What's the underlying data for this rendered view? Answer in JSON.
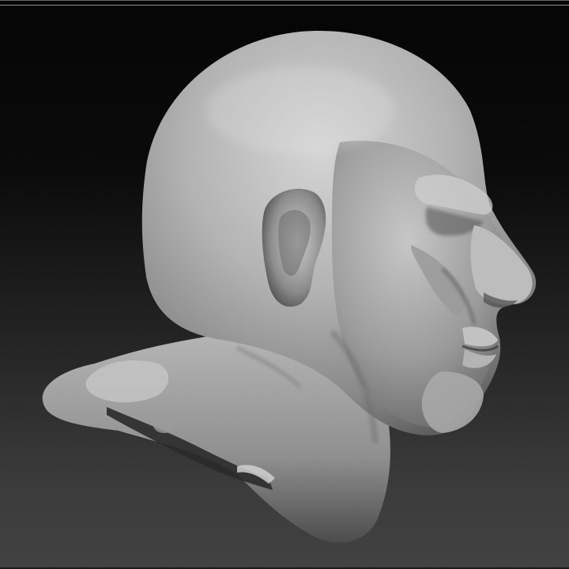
{
  "viewport": {
    "subject_icon": "sculpted-head-icon",
    "background_top_color": "#050505",
    "background_bottom_color": "#424242",
    "material_color": "#a9a9a9"
  }
}
